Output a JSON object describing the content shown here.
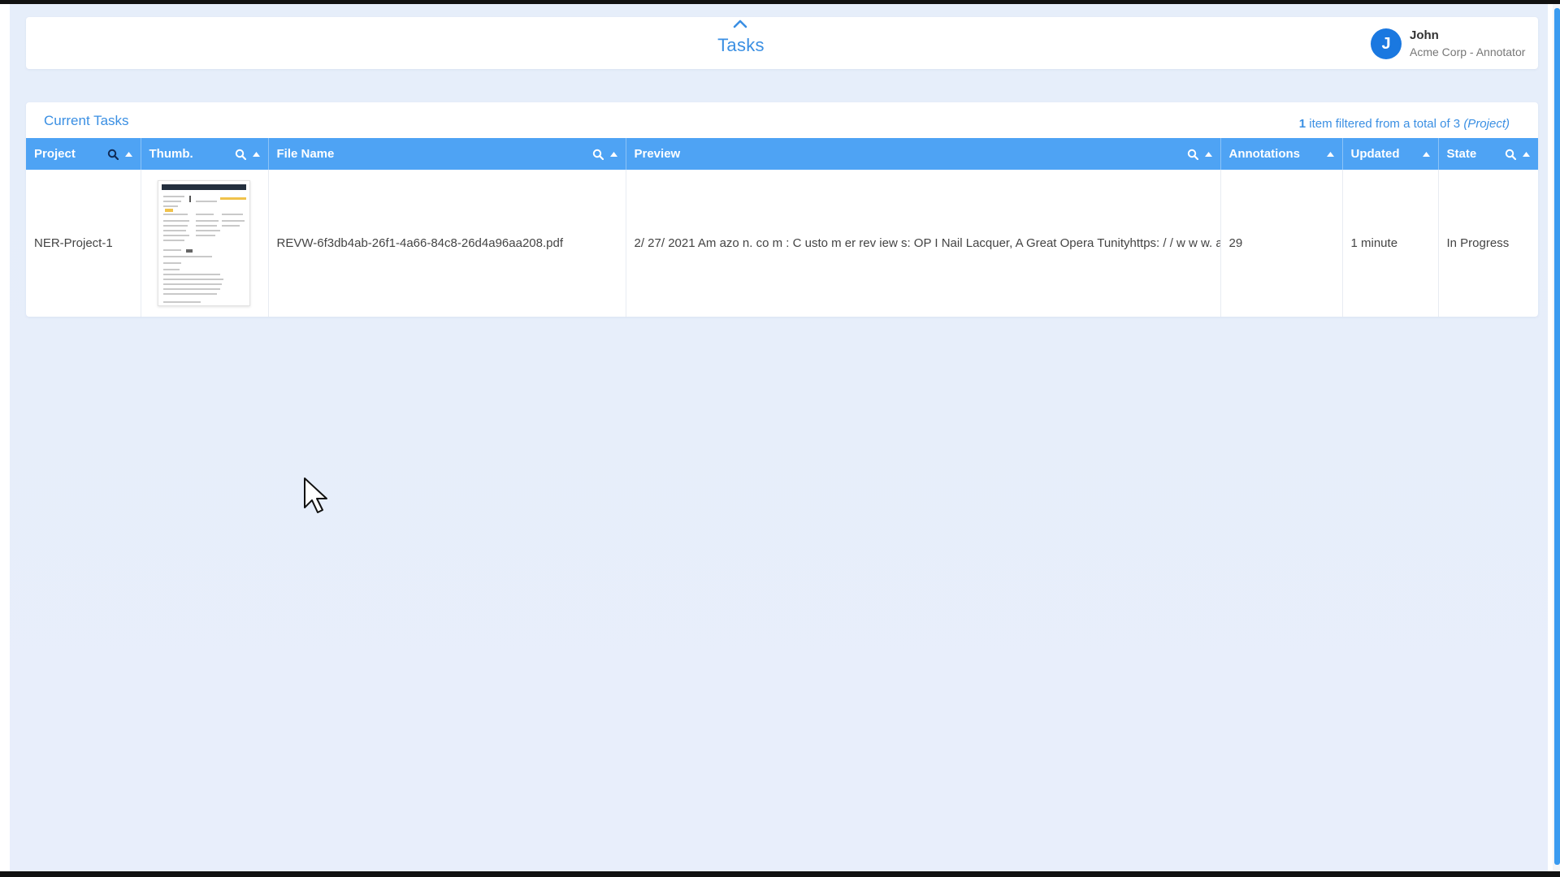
{
  "header": {
    "title": "Tasks",
    "user": {
      "initial": "J",
      "name": "John",
      "role": "Acme Corp - Annotator"
    }
  },
  "panel": {
    "title": "Current Tasks",
    "filter": {
      "count": "1",
      "text": " item filtered from a total of 3 ",
      "scope": "(Project)"
    }
  },
  "table": {
    "columns": [
      {
        "label": "Project",
        "search": true,
        "sort": true
      },
      {
        "label": "Thumb.",
        "search": true,
        "sort": true
      },
      {
        "label": "File Name",
        "search": true,
        "sort": true
      },
      {
        "label": "Preview",
        "search": true,
        "sort": true
      },
      {
        "label": "Annotations",
        "search": false,
        "sort": true
      },
      {
        "label": "Updated",
        "search": false,
        "sort": true
      },
      {
        "label": "State",
        "search": true,
        "sort": true
      }
    ],
    "rows": [
      {
        "project": "NER-Project-1",
        "file_name": "REVW-6f3db4ab-26f1-4a66-84c8-26d4a96aa208.pdf",
        "preview": "2/ 27/ 2021 Am azo n. co m : C usto m er rev iew s: OP I Nail Lacquer, A Great Opera Tunityhttps: / / w w w. am azo",
        "annotations": "29",
        "updated": "1 minute",
        "state": "In Progress"
      }
    ]
  },
  "colors": {
    "accent": "#3a8fe3",
    "header_bg": "#4ea3f4",
    "avatar": "#1a78e0"
  },
  "icons": [
    "chevron-up-icon",
    "search-icon",
    "sort-up-icon",
    "mouse-cursor-icon"
  ]
}
